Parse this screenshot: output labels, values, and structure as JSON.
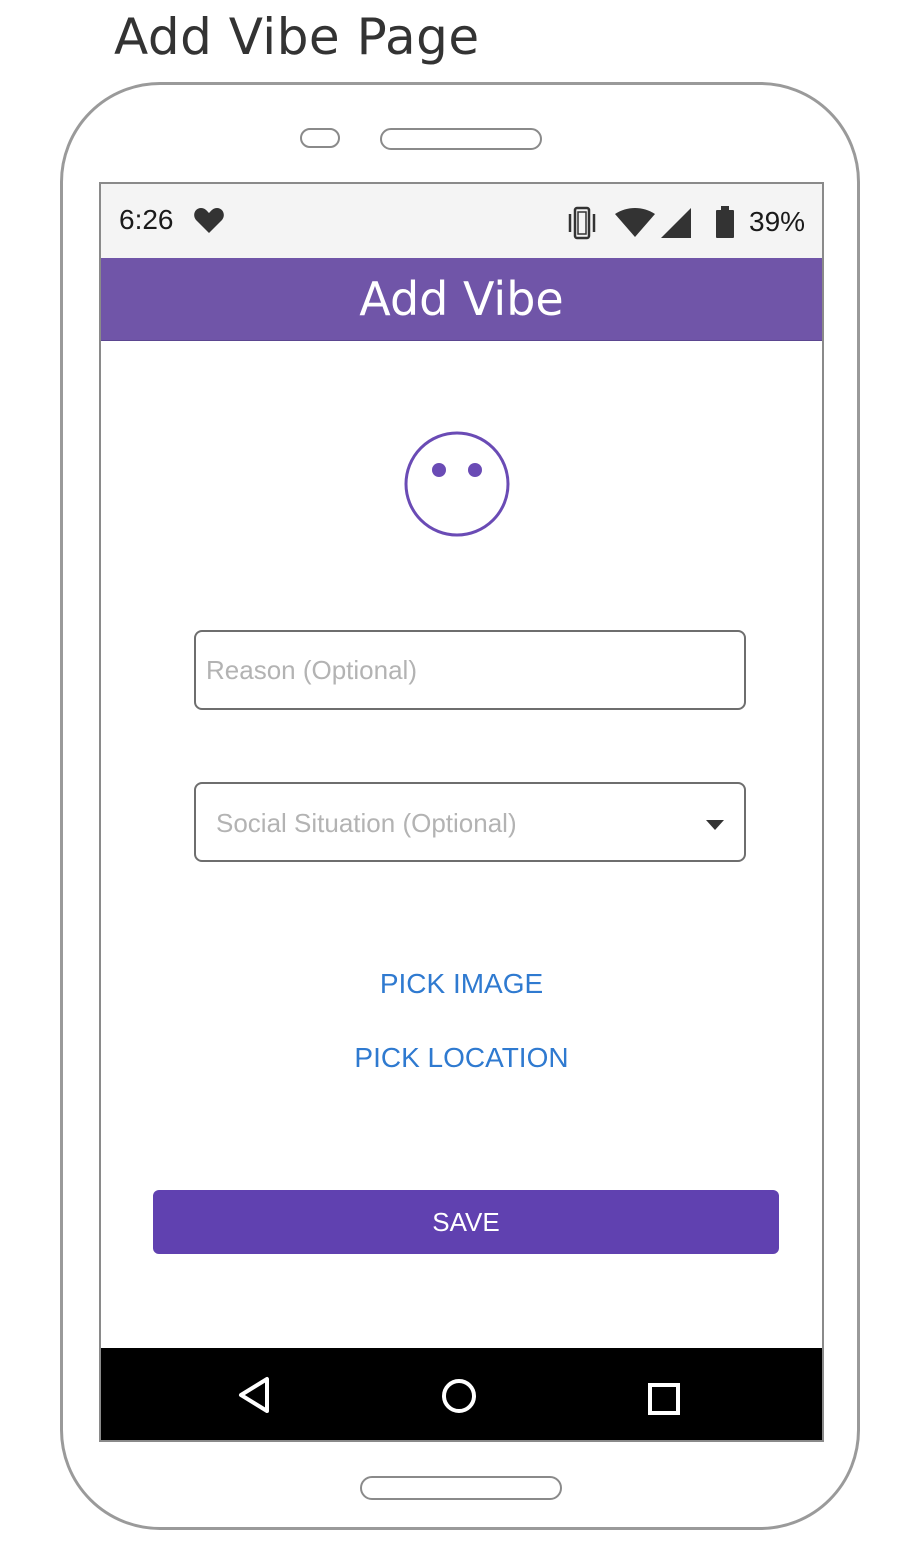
{
  "page_heading": "Add Vibe Page",
  "status_bar": {
    "time": "6:26",
    "battery": "39%",
    "icons": [
      "heart-icon",
      "vibrate-icon",
      "wifi-icon",
      "signal-icon",
      "battery-icon"
    ]
  },
  "app_bar": {
    "title": "Add Vibe"
  },
  "mood_icon": "neutral-face-icon",
  "form": {
    "reason_placeholder": "Reason (Optional)",
    "reason_value": "",
    "social_situation_placeholder": "Social Situation (Optional)"
  },
  "actions": {
    "pick_image": "PICK IMAGE",
    "pick_location": "PICK LOCATION",
    "save": "SAVE"
  },
  "nav_bar": {
    "icons": [
      "back-icon",
      "home-icon",
      "recents-icon"
    ]
  },
  "colors": {
    "app_bar": "#7055a8",
    "accent": "#6041b0",
    "link": "#2f7ad0",
    "face_stroke": "#6a4bb5"
  }
}
